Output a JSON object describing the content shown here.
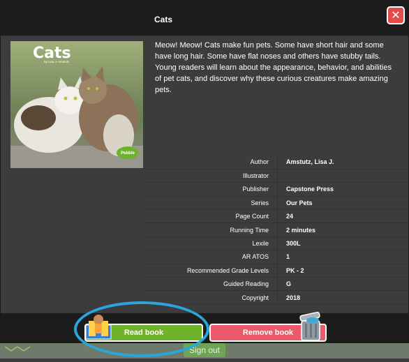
{
  "modal": {
    "title": "Cats",
    "close_label": "✕"
  },
  "cover": {
    "title": "Cats",
    "author_line": "by Lisa J. Amstutz",
    "imprint": "Pebble"
  },
  "description": "Meow! Meow! Cats make fun pets. Some have short hair and some have long hair. Some have flat noses and others have stubby tails. Young readers will learn about the appearance, behavior, and abilities of pet cats, and discover why these curious creatures make amazing pets.",
  "details": [
    {
      "label": "Author",
      "value": "Amstutz, Lisa J."
    },
    {
      "label": "Illustrator",
      "value": ""
    },
    {
      "label": "Publisher",
      "value": "Capstone Press"
    },
    {
      "label": "Series",
      "value": "Our Pets"
    },
    {
      "label": "Page Count",
      "value": "24"
    },
    {
      "label": "Running Time",
      "value": "2 minutes"
    },
    {
      "label": "Lexile",
      "value": "300L"
    },
    {
      "label": "AR ATOS",
      "value": "1"
    },
    {
      "label": "Recommended Grade Levels",
      "value": "PK - 2"
    },
    {
      "label": "Guided Reading",
      "value": "G"
    },
    {
      "label": "Copyright",
      "value": "2018"
    }
  ],
  "actions": {
    "read_label": "Read book",
    "remove_label": "Remove book"
  },
  "backdrop": {
    "signout_label": "Sign out"
  },
  "colors": {
    "read_green": "#6fb22c",
    "remove_red": "#ea5a6a",
    "close_red": "#e44c4c",
    "highlight_blue": "#29a7dc"
  }
}
